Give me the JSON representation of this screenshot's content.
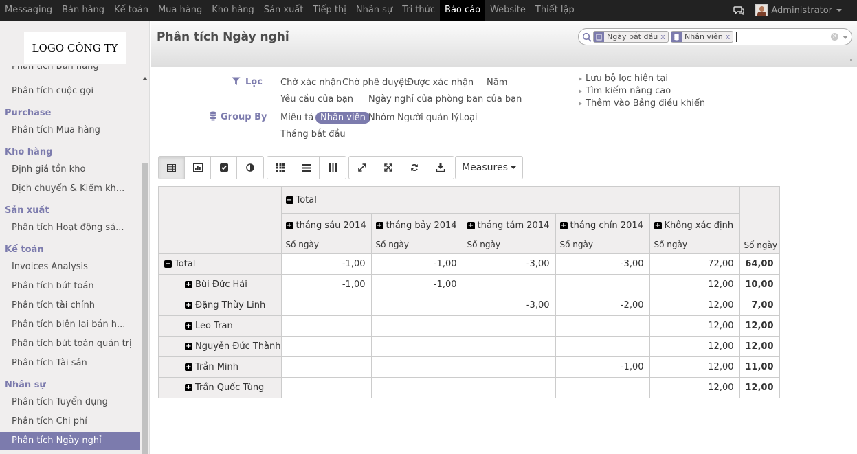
{
  "topnav": {
    "items": [
      "Messaging",
      "Bán hàng",
      "Kế toán",
      "Mua hàng",
      "Kho hàng",
      "Sản xuất",
      "Tiếp thị",
      "Nhân sự",
      "Tri thức",
      "Báo cáo",
      "Website",
      "Thiết lập"
    ],
    "active": "Báo cáo",
    "user": "Administrator"
  },
  "sidebar": {
    "logo": "LOGO CÔNG TY",
    "partial_item": "Phân tích Bán hàng",
    "first_item": "Phân tích cuộc gọi",
    "sections": [
      {
        "title": "Purchase",
        "items": [
          "Phân tích Mua hàng"
        ]
      },
      {
        "title": "Kho hàng",
        "items": [
          "Định giá tồn kho",
          "Dịch chuyển & Kiểm kh..."
        ]
      },
      {
        "title": "Sản xuất",
        "items": [
          "Phân tích Hoạt động sả..."
        ]
      },
      {
        "title": "Kế toán",
        "items": [
          "Invoices Analysis",
          "Phân tích bút toán",
          "Phân tích tài chính",
          "Phân tích biên lai bán h...",
          "Phân tích bút toán quản trị",
          "Phân tích Tài sản"
        ]
      },
      {
        "title": "Nhân sự",
        "items": [
          "Phân tích Tuyển dụng",
          "Phân tích Chi phí",
          "Phân tích Ngày nghỉ"
        ]
      }
    ],
    "active": "Phân tích Ngày nghỉ"
  },
  "header": {
    "title": "Phân tích Ngày nghỉ",
    "facets": [
      "Ngày bắt đầu",
      "Nhân viên"
    ]
  },
  "filters": {
    "filter_label": "Lọc",
    "groupby_label": "Group By",
    "filter_options": [
      "Chờ xác nhận",
      "Chờ phê duyệt",
      "Được xác nhận",
      "Năm",
      "Yêu cầu của bạn",
      "Ngày nghỉ của phòng ban của bạn"
    ],
    "groupby_options": [
      "Miêu tả",
      "Nhân viên",
      "Nhóm",
      "Người quản lý",
      "Loại",
      "Tháng bắt đầu"
    ],
    "groupby_selected": "Nhân viên",
    "links": [
      "Lưu bộ lọc hiện tại",
      "Tìm kiếm nâng cao",
      "Thêm vào Bảng điều khiển"
    ]
  },
  "toolbar": {
    "measures_label": "Measures"
  },
  "pivot": {
    "total_label": "Total",
    "measure": "Số ngày",
    "columns": [
      "tháng sáu 2014",
      "tháng bảy 2014",
      "tháng tám 2014",
      "tháng chín 2014",
      "Không xác định"
    ],
    "rows": [
      {
        "label": "Total",
        "values": [
          "-1,00",
          "-1,00",
          "-3,00",
          "-3,00",
          "72,00"
        ],
        "total": "64,00"
      },
      {
        "label": "Bùi Đức Hải",
        "values": [
          "-1,00",
          "-1,00",
          "",
          "",
          "12,00"
        ],
        "total": "10,00"
      },
      {
        "label": "Đặng Thùy Linh",
        "values": [
          "",
          "",
          "-3,00",
          "-2,00",
          "12,00"
        ],
        "total": "7,00"
      },
      {
        "label": "Leo Tran",
        "values": [
          "",
          "",
          "",
          "",
          "12,00"
        ],
        "total": "12,00"
      },
      {
        "label": "Nguyễn Đức Thành",
        "values": [
          "",
          "",
          "",
          "",
          "12,00"
        ],
        "total": "12,00"
      },
      {
        "label": "Trần Minh",
        "values": [
          "",
          "",
          "",
          "-1,00",
          "12,00"
        ],
        "total": "11,00"
      },
      {
        "label": "Trần Quốc Tùng",
        "values": [
          "",
          "",
          "",
          "",
          "12,00"
        ],
        "total": "12,00"
      }
    ]
  }
}
